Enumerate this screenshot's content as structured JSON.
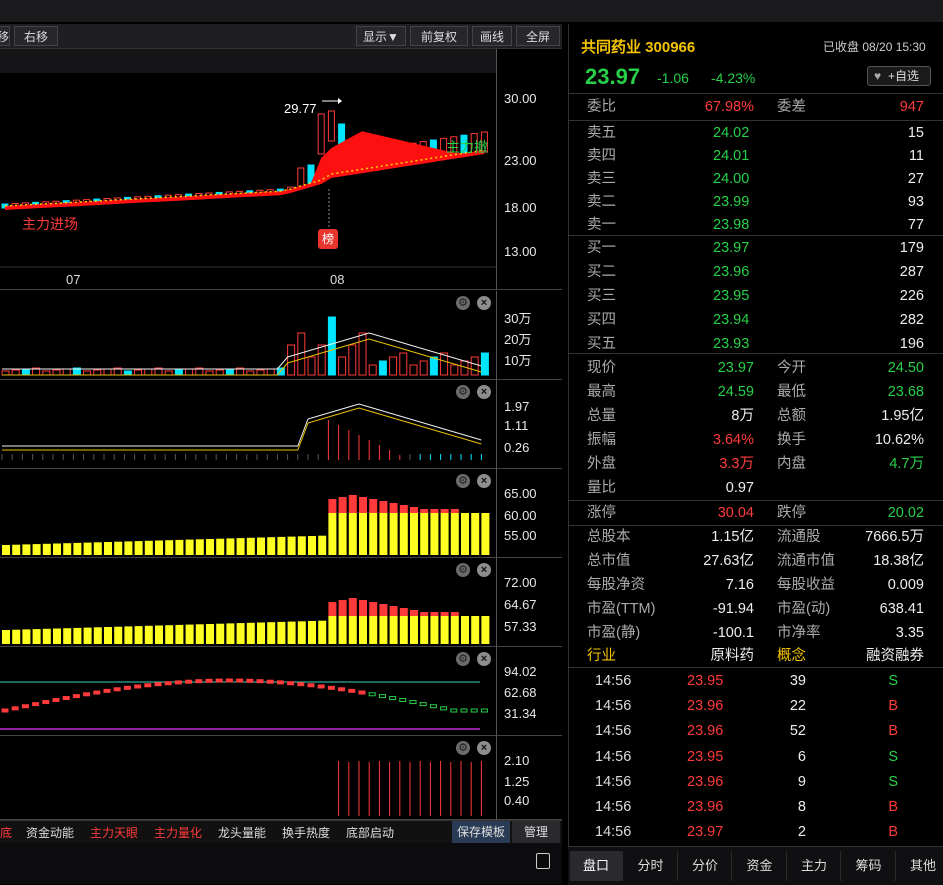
{
  "toolbar": {
    "left_glyph": "移",
    "right_move": "右移",
    "display": "显示▼",
    "adjust": "前复权▼",
    "draw": "画线",
    "fullscreen": "全屏"
  },
  "main_chart": {
    "y_ticks": [
      "30.00",
      "23.00",
      "18.00",
      "13.00"
    ],
    "x_ticks": [
      "07",
      "08"
    ],
    "peak_label": "29.77",
    "label_enter": "主力进场",
    "label_exit": "主力撤",
    "badge": "榜"
  },
  "vol_panel": {
    "ticks": [
      "30万",
      "20万",
      "10万"
    ]
  },
  "ind2_panel": {
    "ticks": [
      "1.97",
      "1.11",
      "0.26"
    ]
  },
  "ind3_panel": {
    "ticks": [
      "65.00",
      "60.00",
      "55.00"
    ]
  },
  "ind4_panel": {
    "ticks": [
      "72.00",
      "64.67",
      "57.33"
    ]
  },
  "ind5_panel": {
    "ticks": [
      "94.02",
      "62.68",
      "31.34"
    ]
  },
  "ind6_panel": {
    "ticks": [
      "2.10",
      "1.25",
      "0.40"
    ]
  },
  "bottom_tabs": {
    "t0": "底",
    "t1": "资金动能",
    "t2": "主力天眼",
    "t3": "主力量化",
    "t4": "龙头量能",
    "t5": "换手热度",
    "t6": "底部启动",
    "save": "保存模板",
    "manage": "管理"
  },
  "quote": {
    "name": "共同药业 300966",
    "status": "已收盘 08/20 15:30",
    "price": "23.97",
    "change": "-1.06",
    "change_pct": "-4.23%",
    "watch": "+自选",
    "weibi_label": "委比",
    "weibi": "67.98%",
    "weicha_label": "委差",
    "weicha": "947",
    "asks": [
      {
        "label": "卖五",
        "price": "24.02",
        "vol": "15"
      },
      {
        "label": "卖四",
        "price": "24.01",
        "vol": "11"
      },
      {
        "label": "卖三",
        "price": "24.00",
        "vol": "27"
      },
      {
        "label": "卖二",
        "price": "23.99",
        "vol": "93"
      },
      {
        "label": "卖一",
        "price": "23.98",
        "vol": "77"
      }
    ],
    "bids": [
      {
        "label": "买一",
        "price": "23.97",
        "vol": "179"
      },
      {
        "label": "买二",
        "price": "23.96",
        "vol": "287"
      },
      {
        "label": "买三",
        "price": "23.95",
        "vol": "226"
      },
      {
        "label": "买四",
        "price": "23.94",
        "vol": "282"
      },
      {
        "label": "买五",
        "price": "23.93",
        "vol": "196"
      }
    ],
    "stats": [
      {
        "l1": "现价",
        "v1": "23.97",
        "c1": "green",
        "l2": "今开",
        "v2": "24.50",
        "c2": "green"
      },
      {
        "l1": "最高",
        "v1": "24.59",
        "c1": "green",
        "l2": "最低",
        "v2": "23.68",
        "c2": "green"
      },
      {
        "l1": "总量",
        "v1": "8万",
        "c1": "white",
        "l2": "总额",
        "v2": "1.95亿",
        "c2": "white"
      },
      {
        "l1": "振幅",
        "v1": "3.64%",
        "c1": "red",
        "l2": "换手",
        "v2": "10.62%",
        "c2": "white"
      },
      {
        "l1": "外盘",
        "v1": "3.3万",
        "c1": "red",
        "l2": "内盘",
        "v2": "4.7万",
        "c2": "green"
      },
      {
        "l1": "量比",
        "v1": "0.97",
        "c1": "white",
        "l2": "",
        "v2": "",
        "c2": "white"
      },
      {
        "l1": "涨停",
        "v1": "30.04",
        "c1": "red",
        "l2": "跌停",
        "v2": "20.02",
        "c2": "green"
      },
      {
        "l1": "总股本",
        "v1": "1.15亿",
        "c1": "white",
        "l2": "流通股",
        "v2": "7666.5万",
        "c2": "white"
      },
      {
        "l1": "总市值",
        "v1": "27.63亿",
        "c1": "white",
        "l2": "流通市值",
        "v2": "18.38亿",
        "c2": "white"
      },
      {
        "l1": "每股净资",
        "v1": "7.16",
        "c1": "white",
        "l2": "每股收益",
        "v2": "0.009",
        "c2": "white"
      },
      {
        "l1": "市盈(TTM)",
        "v1": "-91.94",
        "c1": "white",
        "l2": "市盈(动)",
        "v2": "638.41",
        "c2": "white"
      },
      {
        "l1": "市盈(静)",
        "v1": "-100.1",
        "c1": "white",
        "l2": "市净率",
        "v2": "3.35",
        "c2": "white"
      }
    ],
    "industry_label": "行业",
    "industry": "原料药",
    "concept_label": "概念",
    "concept": "融资融券",
    "ticks": [
      {
        "time": "14:56",
        "price": "23.95",
        "vol": "39",
        "side": "S"
      },
      {
        "time": "14:56",
        "price": "23.96",
        "vol": "22",
        "side": "B"
      },
      {
        "time": "14:56",
        "price": "23.96",
        "vol": "52",
        "side": "B"
      },
      {
        "time": "14:56",
        "price": "23.95",
        "vol": "6",
        "side": "S"
      },
      {
        "time": "14:56",
        "price": "23.96",
        "vol": "9",
        "side": "S"
      },
      {
        "time": "14:56",
        "price": "23.96",
        "vol": "8",
        "side": "B"
      },
      {
        "time": "14:56",
        "price": "23.97",
        "vol": "2",
        "side": "B"
      }
    ]
  },
  "right_tabs": [
    "盘口",
    "分时",
    "分价",
    "资金",
    "主力",
    "筹码",
    "其他"
  ],
  "colors": {
    "up": "#ff3a3a",
    "down": "#28d04a",
    "yellow": "#ffff22",
    "cyan": "#00e5ff",
    "gold": "#f5c400"
  }
}
